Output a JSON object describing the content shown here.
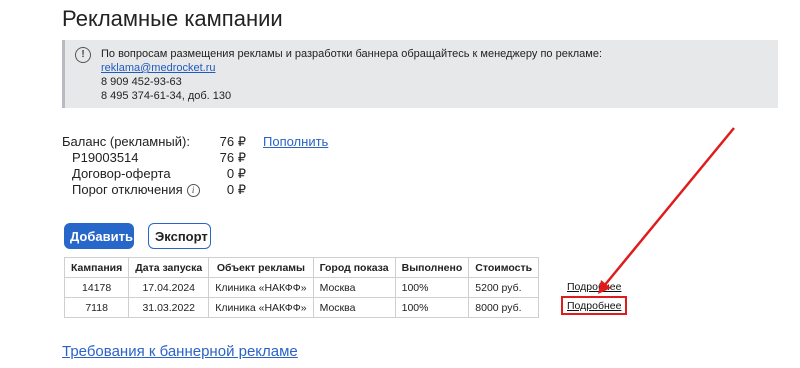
{
  "page": {
    "title": "Рекламные кампании"
  },
  "notice": {
    "icon": "exclamation-icon",
    "line1": "По вопросам размещения рекламы и разработки баннера обращайтесь к менеджеру по рекламе:",
    "email": "reklama@medrocket.ru",
    "phone1": "8 909 452-93-63",
    "phone2": "8 495 374-61-34, доб. 130"
  },
  "balance": {
    "label": "Баланс (рекламный):",
    "value": "76 ₽",
    "topup_label": "Пополнить",
    "rows": [
      {
        "label": "P19003514",
        "value": "76 ₽"
      },
      {
        "label": "Договор-оферта",
        "value": "0 ₽"
      },
      {
        "label": "Порог отключения",
        "value": "0 ₽",
        "info_icon": "i"
      }
    ]
  },
  "actions": {
    "add_label": "Добавить",
    "export_label": "Экспорт"
  },
  "table": {
    "headers": [
      "Кампания",
      "Дата запуска",
      "Объект рекламы",
      "Город показа",
      "Выполнено",
      "Стоимость"
    ],
    "rows": [
      {
        "id": "14178",
        "date": "17.04.2024",
        "object": "Клиника «НАКФФ»",
        "city": "Москва",
        "done": "100%",
        "cost": "5200 руб.",
        "more": "Подробнее"
      },
      {
        "id": "7118",
        "date": "31.03.2022",
        "object": "Клиника «НАКФФ»",
        "city": "Москва",
        "done": "100%",
        "cost": "8000 руб.",
        "more": "Подробнее"
      }
    ]
  },
  "footer": {
    "link_label": "Требования к баннерной рекламе"
  },
  "annotation": {
    "color": "#e01b1b"
  }
}
